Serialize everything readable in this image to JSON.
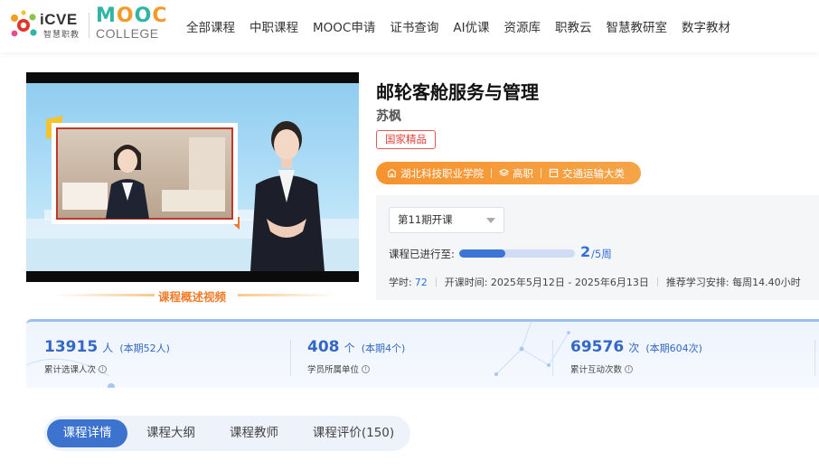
{
  "brand": {
    "icve_word": "iCVE",
    "icve_sub": "智慧职教",
    "mooc_word": "MOOC",
    "mooc_college": "COLLEGE"
  },
  "nav": [
    "全部课程",
    "中职课程",
    "MOOC申请",
    "证书查询",
    "AI优课",
    "资源库",
    "职教云",
    "智慧教研室",
    "数字教材"
  ],
  "video": {
    "caption": "课程概述视频"
  },
  "course": {
    "title": "邮轮客舱服务与管理",
    "teacher": "苏枫",
    "badge": "国家精品",
    "school": "湖北科技职业学院",
    "level": "高职",
    "category": "交通运输大类",
    "term": "第11期开课",
    "progress_label": "课程已进行至:",
    "progress_current": "2",
    "progress_total_text": "/5周",
    "progress_fraction": 0.4,
    "hours_label": "学时:",
    "hours_value": "72",
    "schedule": "开课时间: 2025年5月12日 - 2025年6月13日",
    "recommend": "推荐学习安排: 每周14.40小时"
  },
  "stats": [
    {
      "num": "13915",
      "unit": "人",
      "current": "(本期52人)",
      "desc": "累计选课人次"
    },
    {
      "num": "408",
      "unit": "个",
      "current": "(本期4个)",
      "desc": "学员所属单位"
    },
    {
      "num": "69576",
      "unit": "次",
      "current": "(本期604次)",
      "desc": "累计互动次数"
    }
  ],
  "tabs": [
    "课程详情",
    "课程大纲",
    "课程教师",
    "课程评价(150)"
  ],
  "colors": {
    "accent": "#3b73cf",
    "orange": "#f7932f",
    "badge_red": "#e0413a"
  }
}
